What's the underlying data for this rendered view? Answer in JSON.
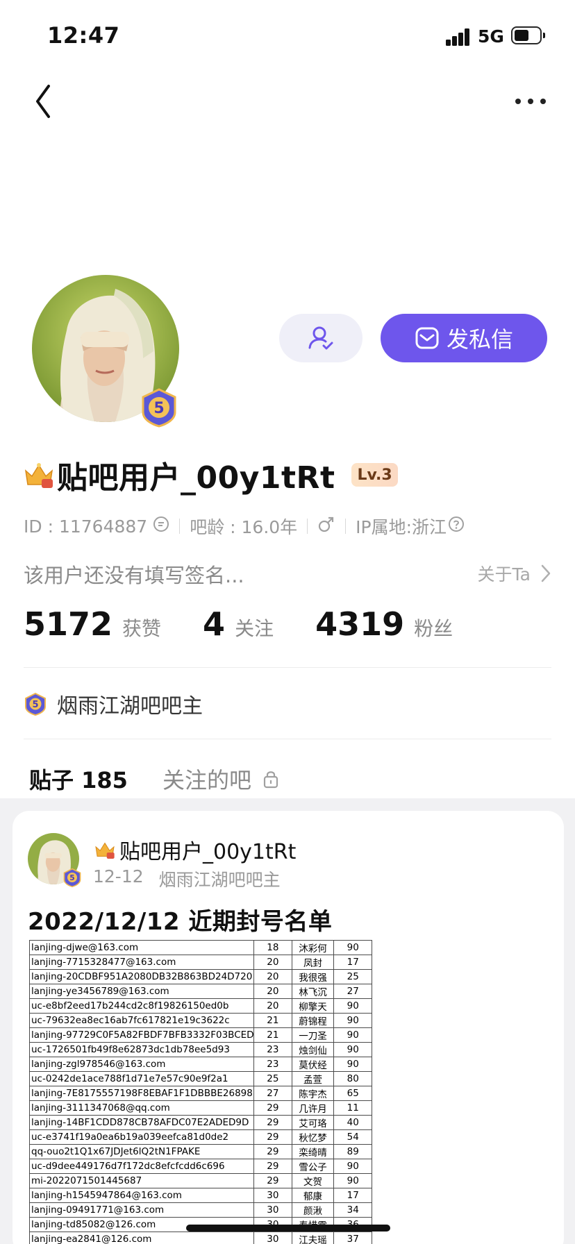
{
  "status": {
    "time": "12:47",
    "network": "5G"
  },
  "profile": {
    "username": "贴吧用户_00y1tRt",
    "level": "Lv.3",
    "badge_level": "5",
    "id_label": "ID : 11764887",
    "age_label": "吧龄 : 16.0年",
    "ip_label": "IP属地:浙江",
    "signature": "该用户还没有填写签名...",
    "about_label": "关于Ta",
    "message_button": "发私信",
    "stats": [
      {
        "value": "5172",
        "label": "获赞"
      },
      {
        "value": "4",
        "label": "关注"
      },
      {
        "value": "4319",
        "label": "粉丝"
      }
    ],
    "manager_title": "烟雨江湖吧吧主"
  },
  "tabs": {
    "posts": "贴子 185",
    "followed": "关注的吧"
  },
  "post": {
    "author": "贴吧用户_00y1tRt",
    "date": "12-12",
    "forum_role": "烟雨江湖吧吧主",
    "title": "2022/12/12 近期封号名单",
    "rows": [
      [
        "lanjing-djwe@163.com",
        "18",
        "沐彩何",
        "90"
      ],
      [
        "lanjing-7715328477@163.com",
        "20",
        "凤封",
        "17"
      ],
      [
        "lanjing-20CDBF951A2080DB32B863BD24D720",
        "20",
        "我很强",
        "25"
      ],
      [
        "lanjing-ye3456789@163.com",
        "20",
        "林飞沉",
        "27"
      ],
      [
        "uc-e8bf2eed17b244cd2c8f19826150ed0b",
        "20",
        "柳擎天",
        "90"
      ],
      [
        "uc-79632ea8ec16ab7fc617821e19c3622c",
        "21",
        "蔚锦程",
        "90"
      ],
      [
        "lanjing-97729C0F5A82FBDF7BFB3332F03BCED",
        "21",
        "一刀圣",
        "90"
      ],
      [
        "uc-1726501fb49f8e62873dc1db78ee5d93",
        "23",
        "烛剑仙",
        "90"
      ],
      [
        "lanjing-zgl978546@163.com",
        "23",
        "莫伏经",
        "90"
      ],
      [
        "uc-0242de1ace788f1d71e7e57c90e9f2a1",
        "25",
        "孟萱",
        "80"
      ],
      [
        "lanjing-7E8175557198F8EBAF1F1DBBBE26898",
        "27",
        "陈宇杰",
        "65"
      ],
      [
        "lanjing-3111347068@qq.com",
        "29",
        "几许月",
        "11"
      ],
      [
        "lanjing-14BF1CDD878CB78AFDC07E2ADED9D",
        "29",
        "艾可珞",
        "40"
      ],
      [
        "uc-e3741f19a0ea6b19a039eefca81d0de2",
        "29",
        "秋忆梦",
        "54"
      ],
      [
        "qq-ouo2t1Q1x67JDJet6lQ2tN1FPAKE",
        "29",
        "栾绮晴",
        "89"
      ],
      [
        "uc-d9dee449176d7f172dc8efcfcdd6c696",
        "29",
        "雪公子",
        "90"
      ],
      [
        "mi-2022071501445687",
        "29",
        "文贺",
        "90"
      ],
      [
        "lanjing-h1545947864@163.com",
        "30",
        "郁康",
        "17"
      ],
      [
        "lanjing-09491771@163.com",
        "30",
        "颜湫",
        "34"
      ],
      [
        "lanjing-td85082@126.com",
        "30",
        "寿惜霜",
        "36"
      ],
      [
        "lanjing-ea2841@126.com",
        "30",
        "江夫瑶",
        "37"
      ]
    ]
  },
  "colors": {
    "accent": "#6e56ec",
    "follow_bg": "#efeff8"
  }
}
